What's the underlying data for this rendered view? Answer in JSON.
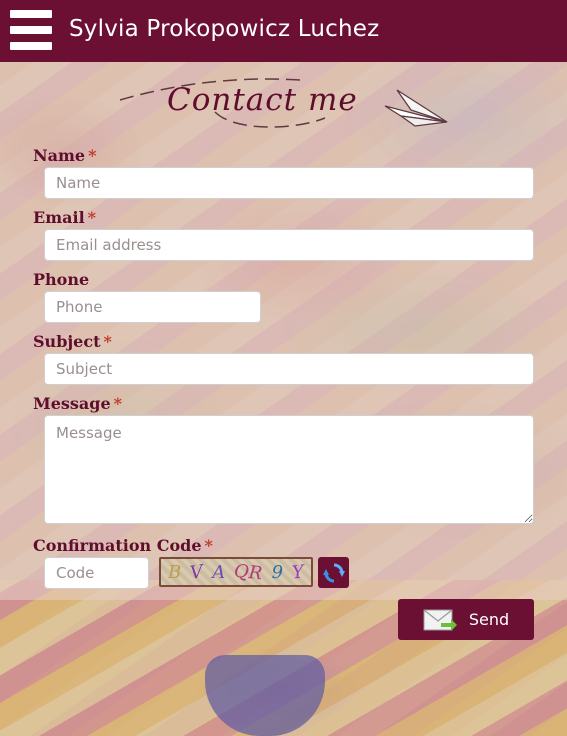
{
  "header": {
    "title": "Sylvia Prokopowicz Luchez",
    "menu_icon": "hamburger-menu-icon"
  },
  "contact_heading": "Contact me",
  "form": {
    "name": {
      "label": "Name",
      "required_mark": "*",
      "placeholder": "Name"
    },
    "email": {
      "label": "Email",
      "required_mark": "*",
      "placeholder": "Email address"
    },
    "phone": {
      "label": "Phone",
      "placeholder": "Phone"
    },
    "subject": {
      "label": "Subject",
      "required_mark": "*",
      "placeholder": "Subject"
    },
    "message": {
      "label": "Message",
      "required_mark": "*",
      "placeholder": "Message"
    },
    "confirmation": {
      "label": "Confirmation Code",
      "required_mark": "*",
      "placeholder": "Code",
      "captcha_chars": [
        "B",
        "V",
        "A",
        "QR",
        "9",
        "Y"
      ]
    },
    "send_label": "Send"
  },
  "colors": {
    "brand": "#6b1033",
    "label": "#5e0d2c",
    "required": "#c0392b"
  }
}
